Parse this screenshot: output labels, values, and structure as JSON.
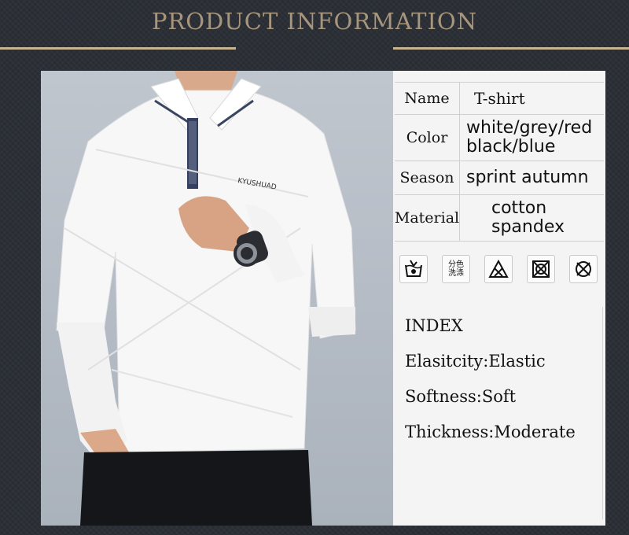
{
  "header": {
    "title": "PRODUCT INFORMATION"
  },
  "photo": {
    "brand_print": "KYUSHUAD"
  },
  "spec_table": [
    {
      "label": "Name",
      "value": "T-shirt"
    },
    {
      "label": "Color",
      "value_lines": [
        "white/grey/red",
        "black/blue"
      ]
    },
    {
      "label": "Season",
      "value": "sprint autumn"
    },
    {
      "label": "Material",
      "value_lines": [
        "cotton",
        "spandex"
      ]
    }
  ],
  "care_icons": [
    {
      "name": "hand-wash-icon"
    },
    {
      "name": "wash-separately-icon",
      "text_lines": [
        "分色",
        "洗涤"
      ]
    },
    {
      "name": "no-bleach-icon"
    },
    {
      "name": "no-tumble-dry-icon"
    },
    {
      "name": "no-dry-clean-icon"
    }
  ],
  "index": {
    "heading": "INDEX",
    "items": [
      "Elasitcity:Elastic",
      "Softness:Soft",
      "Thickness:Moderate"
    ]
  },
  "colors": {
    "background": "#2b2f36",
    "title": "#a8967c",
    "accent_line": "#c8b594",
    "panel": "#f4f4f4"
  }
}
